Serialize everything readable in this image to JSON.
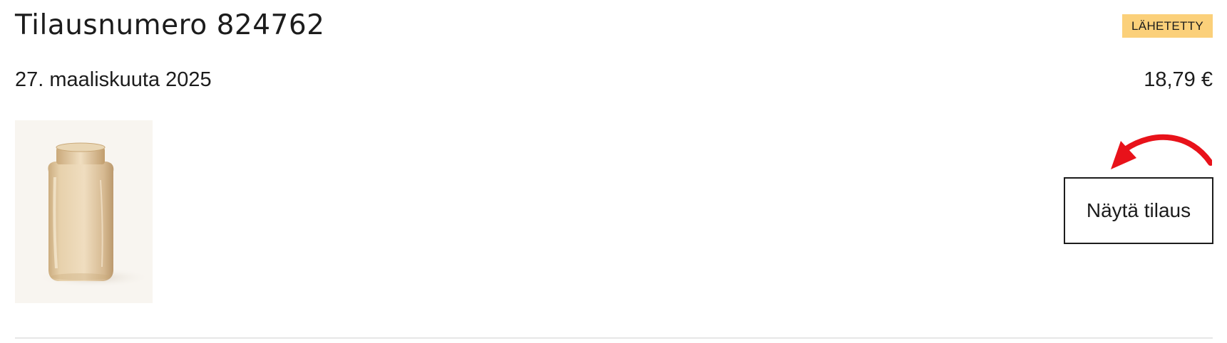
{
  "order": {
    "title": "Tilausnumero 824762",
    "status": "LÄHETETTY",
    "date": "27. maaliskuuta 2025",
    "total": "18,79 €",
    "view_button_label": "Näytä tilaus"
  },
  "colors": {
    "status_badge_background": "#fbd07a",
    "annotation_arrow": "#e8121a",
    "text": "#1c1c1c"
  },
  "icons": {
    "annotation": "red-curved-arrow-icon",
    "product": "glass-vase-image"
  }
}
